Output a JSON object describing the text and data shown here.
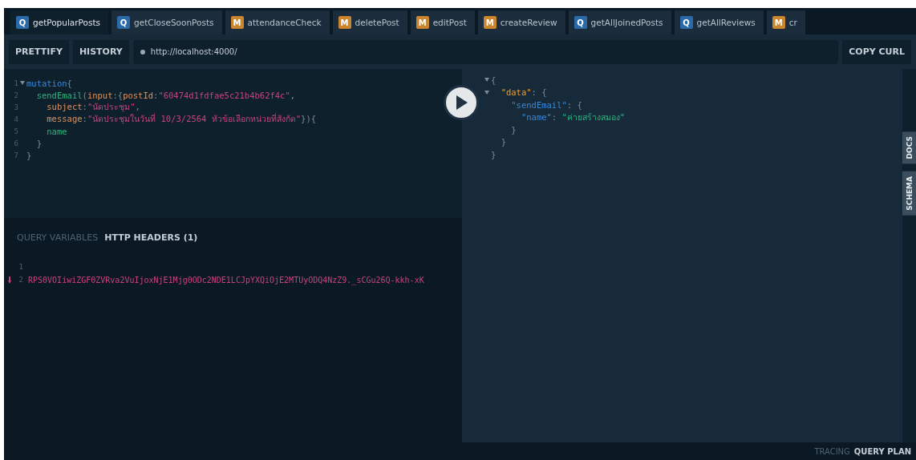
{
  "tabs": [
    {
      "badge": "Q",
      "kind": "query",
      "label": "getPopularPosts",
      "selected": true
    },
    {
      "badge": "Q",
      "kind": "query",
      "label": "getCloseSoonPosts",
      "selected": false
    },
    {
      "badge": "M",
      "kind": "mutation",
      "label": "attendanceCheck",
      "selected": false
    },
    {
      "badge": "M",
      "kind": "mutation",
      "label": "deletePost",
      "selected": false
    },
    {
      "badge": "M",
      "kind": "mutation",
      "label": "editPost",
      "selected": false
    },
    {
      "badge": "M",
      "kind": "mutation",
      "label": "createReview",
      "selected": false
    },
    {
      "badge": "Q",
      "kind": "query",
      "label": "getAllJoinedPosts",
      "selected": false
    },
    {
      "badge": "Q",
      "kind": "query",
      "label": "getAllReviews",
      "selected": false
    },
    {
      "badge": "M",
      "kind": "mutation",
      "label": "cr",
      "selected": false
    }
  ],
  "toolbar": {
    "buttons": [
      "PRETTIFY",
      "HISTORY"
    ],
    "url": "http://localhost:4000/",
    "copy_button": "COPY CURL"
  },
  "query_editor": {
    "lines": [
      {
        "number": "1",
        "foldable": true,
        "tokens": [
          {
            "kind": "keyword",
            "text": "mutation"
          },
          {
            "kind": "punct",
            "text": "{"
          }
        ]
      },
      {
        "number": "2",
        "foldable": false,
        "tokens": [
          {
            "kind": "field",
            "text": "  sendEmail"
          },
          {
            "kind": "punct",
            "text": "("
          },
          {
            "kind": "attr",
            "text": "input"
          },
          {
            "kind": "punct",
            "text": ":{"
          },
          {
            "kind": "attr",
            "text": "postId"
          },
          {
            "kind": "punct",
            "text": ":"
          },
          {
            "kind": "string",
            "text": "\"60474d1fdfae5c21b4b62f4c\""
          },
          {
            "kind": "punct",
            "text": ","
          }
        ]
      },
      {
        "number": "3",
        "foldable": false,
        "tokens": [
          {
            "kind": "attr",
            "text": "    subject"
          },
          {
            "kind": "punct",
            "text": ":"
          },
          {
            "kind": "string",
            "text": "\"นัดประชุม\""
          },
          {
            "kind": "punct",
            "text": ","
          }
        ]
      },
      {
        "number": "4",
        "foldable": false,
        "tokens": [
          {
            "kind": "attr",
            "text": "    message"
          },
          {
            "kind": "punct",
            "text": ":"
          },
          {
            "kind": "string",
            "text": "\"นัดประชุมในวันที่ 10/3/2564 หัวข้อเลือกหน่วยที่สังกัด\""
          },
          {
            "kind": "punct",
            "text": "}){"
          }
        ]
      },
      {
        "number": "5",
        "foldable": false,
        "tokens": [
          {
            "kind": "field",
            "text": "    name"
          }
        ]
      },
      {
        "number": "6",
        "foldable": false,
        "tokens": [
          {
            "kind": "punct",
            "text": "  }"
          }
        ]
      },
      {
        "number": "7",
        "foldable": false,
        "tokens": [
          {
            "kind": "punct",
            "text": "}"
          }
        ]
      }
    ]
  },
  "bottom_tabs": [
    {
      "label": "QUERY VARIABLES",
      "selected": false
    },
    {
      "label": "HTTP HEADERS (1)",
      "selected": true
    }
  ],
  "headers_editor": {
    "lines": [
      {
        "number": "1",
        "error": false
      },
      {
        "number": "2",
        "error": true,
        "text": "RPS0VOIiwiZGF0ZVRva2VuIjoxNjE1Mjg0ODc2NDE1LCJpYXQiOjE2MTUyODQ4NzZ9._sCGu26Q-kkh-xK"
      }
    ]
  },
  "result": {
    "lines": [
      {
        "foldable": true,
        "tokens": [
          {
            "kind": "punct",
            "text": "{"
          }
        ]
      },
      {
        "foldable": true,
        "tokens": [
          {
            "kind": "key",
            "text": "  \"data\""
          },
          {
            "kind": "punct",
            "text": ": {"
          }
        ]
      },
      {
        "foldable": false,
        "tokens": [
          {
            "kind": "field2",
            "text": "    \"sendEmail\""
          },
          {
            "kind": "punct",
            "text": ": {"
          }
        ]
      },
      {
        "foldable": false,
        "tokens": [
          {
            "kind": "field2",
            "text": "      \"name\""
          },
          {
            "kind": "punct",
            "text": ": "
          },
          {
            "kind": "value",
            "text": "\"ค่ายสร้างสมอง\""
          }
        ]
      },
      {
        "foldable": false,
        "tokens": [
          {
            "kind": "punct",
            "text": "    }"
          }
        ]
      },
      {
        "foldable": false,
        "tokens": [
          {
            "kind": "punct",
            "text": "  }"
          }
        ]
      },
      {
        "foldable": false,
        "tokens": [
          {
            "kind": "punct",
            "text": "}"
          }
        ]
      }
    ]
  },
  "side_tabs": [
    "DOCS",
    "SCHEMA"
  ],
  "footer": [
    {
      "label": "TRACING",
      "selected": false
    },
    {
      "label": "QUERY PLAN",
      "selected": true
    }
  ]
}
